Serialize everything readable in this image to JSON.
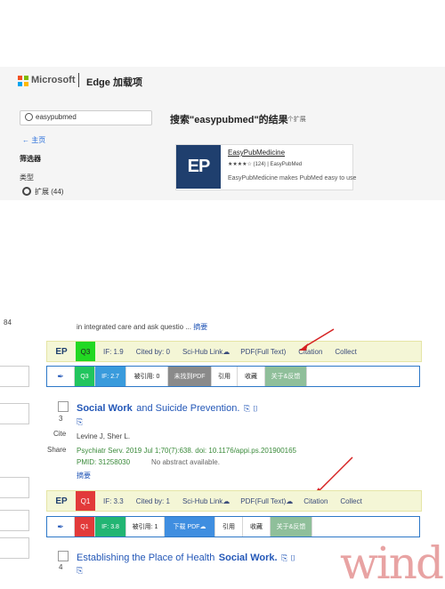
{
  "header": {
    "brand": "Microsoft",
    "title": "Edge 加载项"
  },
  "sidebar": {
    "search_value": "easypubmed",
    "home_link": "主页",
    "filter_heading": "筛选器",
    "type_heading": "类型",
    "type_option": "扩展 (44)"
  },
  "results": {
    "heading": "搜索\"easypubmed\"的结果",
    "count": "44 个扩展",
    "card": {
      "logo": "EP",
      "name": "EasyPubMedicine",
      "rating": "★★★★☆ (124) | EasyPubMed",
      "description": "EasyPubMedicine makes PubMed easy to use"
    }
  },
  "list": {
    "partial_num": "84",
    "partial_text": "in integrated care and ask questio ...",
    "abstract_link": "摘要",
    "bar_common": {
      "logo": "EP",
      "sci_hub": "Sci-Hub Link",
      "pdf": "PDF(Full Text)",
      "citation": "Citation",
      "collect": "Collect",
      "if_label_cn": "IF:",
      "cited_label_cn": "被引用:",
      "cite_btn": "引用",
      "collect_btn": "收藏",
      "feedback_btn": "关于&反馈"
    },
    "bar1": {
      "quartile": "Q3",
      "if": "IF: 1.9",
      "cited": "Cited by: 0",
      "if2": "IF: 2.7",
      "cited2": "被引用: 0",
      "pdf2": "未找到PDF"
    },
    "article1": {
      "number": "3",
      "title_bold": "Social Work",
      "title_rest": "and Suicide Prevention.",
      "authors": "Levine J, Sher L.",
      "source": "Psychiatr Serv. 2019 Jul 1;70(7):638. doi: 10.1176/appi.ps.201900165",
      "pmid": "PMID: 31258030",
      "no_abstract": "No abstract available.",
      "abstract_link": "摘要",
      "cite_label": "Cite",
      "share_label": "Share"
    },
    "bar2": {
      "quartile": "Q1",
      "if": "IF: 3.3",
      "cited": "Cited by: 1",
      "if2": "IF: 3.8",
      "cited2": "被引用: 1",
      "pdf2": "下载 PDF"
    },
    "article2": {
      "number": "4",
      "title_rest": "Establishing the Place of Health",
      "title_bold": "Social Work."
    }
  },
  "watermark": "wind",
  "colors": {
    "q3": "#22d822",
    "q1": "#e23a3a",
    "if_bg": "#3a9bdc",
    "gray_btn": "#8a8a8a",
    "blue_btn": "#3f8ee0",
    "feedback": "#8fbf9a"
  }
}
